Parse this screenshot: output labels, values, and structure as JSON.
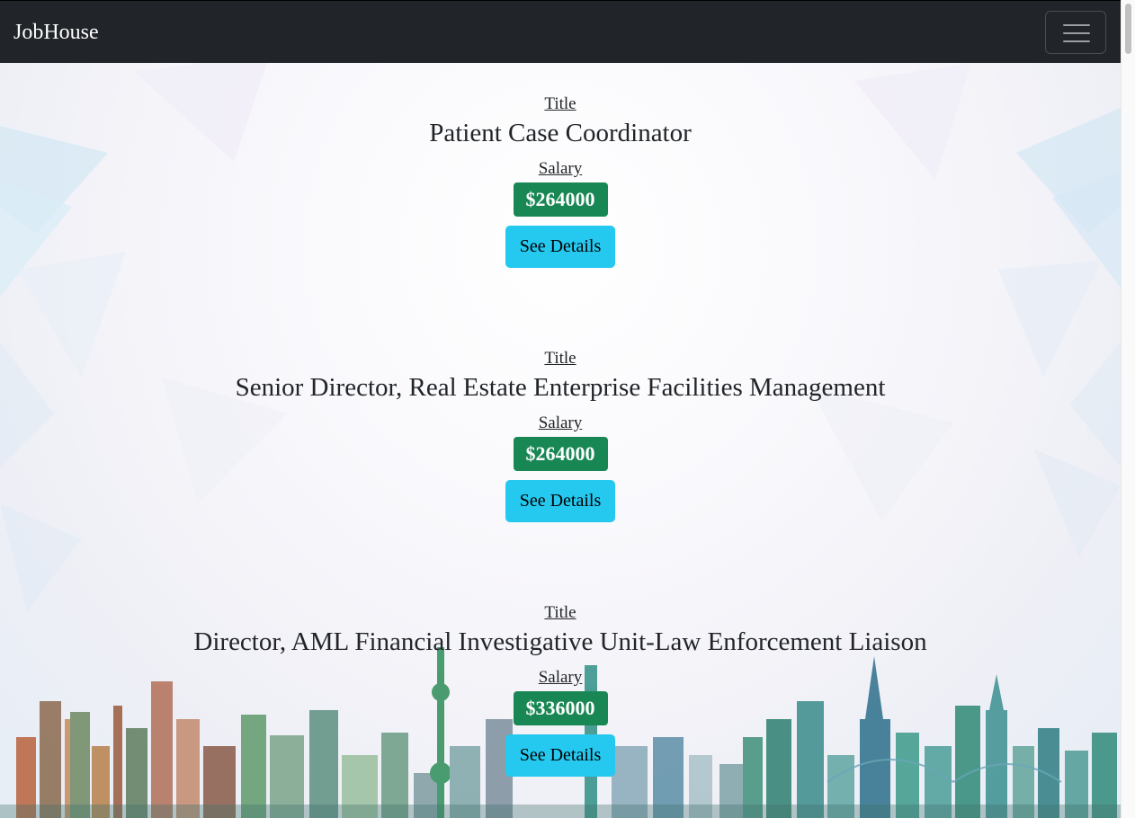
{
  "navbar": {
    "brand": "JobHouse",
    "toggler_icon": "hamburger-menu-icon"
  },
  "jobs": [
    {
      "title_label": "Title",
      "title": "Patient Case Coordinator",
      "salary_label": "Salary",
      "salary": "$264000",
      "button_label": "See Details"
    },
    {
      "title_label": "Title",
      "title": "Senior Director, Real Estate Enterprise Facilities Management",
      "salary_label": "Salary",
      "salary": "$264000",
      "button_label": "See Details"
    },
    {
      "title_label": "Title",
      "title": "Director, AML Financial Investigative Unit-Law Enforcement Liaison",
      "salary_label": "Salary",
      "salary": "$336000",
      "button_label": "See Details"
    }
  ],
  "colors": {
    "navbar_bg": "#212529",
    "salary_badge": "#198754",
    "details_button": "#25c9f0"
  }
}
